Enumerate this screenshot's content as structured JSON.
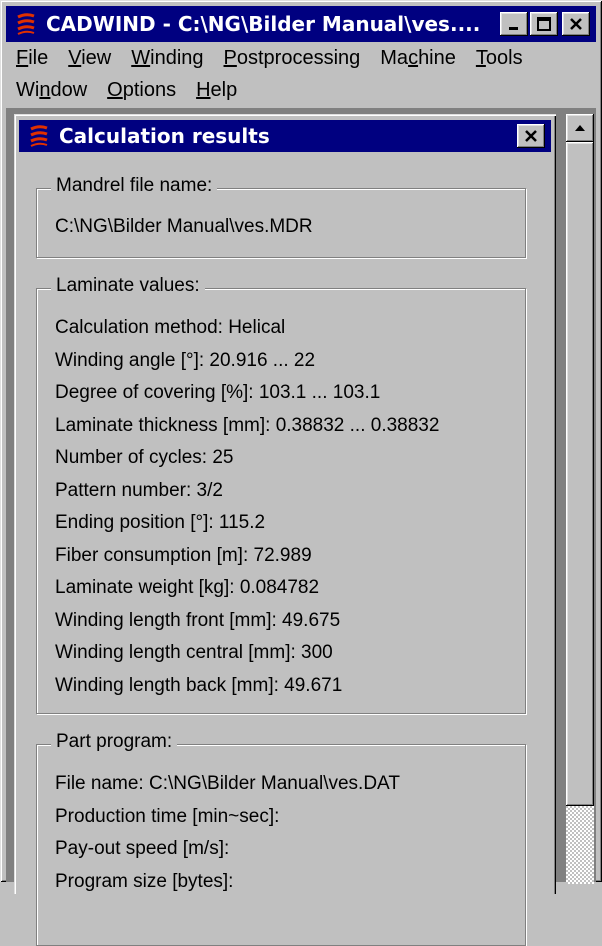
{
  "window": {
    "title": "CADWIND - C:\\NG\\Bilder Manual\\ves....",
    "controls": {
      "minimize": "minimize",
      "maximize": "maximize",
      "close": "close"
    }
  },
  "menu": {
    "row1": [
      {
        "label": "File",
        "underline": "F",
        "rest": "ile"
      },
      {
        "label": "View",
        "underline": "V",
        "rest": "iew"
      },
      {
        "label": "Winding",
        "underline": "W",
        "rest": "inding"
      },
      {
        "label": "Postprocessing",
        "underline": "P",
        "rest": "ostprocessing"
      },
      {
        "label": "Machine",
        "pre": "Ma",
        "underline": "c",
        "rest": "hine"
      },
      {
        "label": "Tools",
        "underline": "T",
        "rest": "ools"
      }
    ],
    "row2": [
      {
        "label": "Window",
        "pre": "Wi",
        "underline": "n",
        "rest": "dow"
      },
      {
        "label": "Options",
        "underline": "O",
        "rest": "ptions"
      },
      {
        "label": "Help",
        "underline": "H",
        "rest": "elp"
      }
    ]
  },
  "dialog": {
    "title": "Calculation results",
    "mandrel": {
      "legend": "Mandrel file name:",
      "value": "C:\\NG\\Bilder Manual\\ves.MDR"
    },
    "laminate": {
      "legend": "Laminate values:",
      "lines": [
        "Calculation method: Helical",
        "Winding angle [°]: 20.916 ... 22",
        "Degree of covering [%]: 103.1 ... 103.1",
        "Laminate thickness [mm]: 0.38832 ... 0.38832",
        "Number of cycles: 25",
        "Pattern number: 3/2",
        "Ending position [°]: 115.2",
        "Fiber consumption [m]: 72.989",
        "Laminate weight [kg]: 0.084782",
        "Winding length front [mm]: 49.675",
        "Winding length central [mm]: 300",
        "Winding length back [mm]: 49.671"
      ]
    },
    "part_program": {
      "legend": "Part program:",
      "lines": [
        "File name: C:\\NG\\Bilder Manual\\ves.DAT",
        "Production time [min~sec]:",
        "Pay-out speed [m/s]:",
        "Program size [bytes]:"
      ]
    }
  },
  "colors": {
    "titlebar": "#000080",
    "face": "#c0c0c0",
    "mdi_bg": "#808080",
    "icon": "#e03000"
  }
}
